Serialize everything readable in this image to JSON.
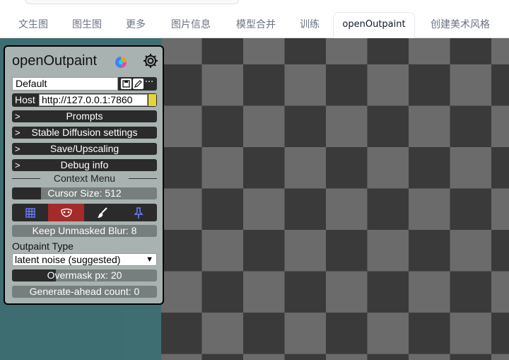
{
  "tabs": [
    {
      "label": "文生图"
    },
    {
      "label": "图生图"
    },
    {
      "label": "更多"
    },
    {
      "label": "图片信息"
    },
    {
      "label": "模型合并"
    },
    {
      "label": "训练"
    },
    {
      "label": "openOutpaint"
    },
    {
      "label": "创建美术风格"
    }
  ],
  "active_tab": "openOutpaint",
  "panel": {
    "title": "openOutpaint",
    "preset": {
      "value": "Default",
      "more_label": "···"
    },
    "host": {
      "label": "Host",
      "value": "http://127.0.0.1:7860"
    },
    "sections": [
      {
        "label": "Prompts"
      },
      {
        "label": "Stable Diffusion settings"
      },
      {
        "label": "Save/Upscaling"
      },
      {
        "label": "Debug info"
      }
    ],
    "context_menu_label": "Context Menu",
    "cursor_size": {
      "label": "Cursor Size: 512",
      "fraction": 0.2
    },
    "tools": [
      {
        "icon": "grid-icon",
        "active": false
      },
      {
        "icon": "mask-icon",
        "active": true
      },
      {
        "icon": "brush-icon",
        "active": false
      },
      {
        "icon": "pin-icon",
        "active": false
      }
    ],
    "keep_unmasked_blur": {
      "label": "Keep Unmasked Blur: 8",
      "fraction": 0.0
    },
    "outpaint_type": {
      "label": "Outpaint Type",
      "value": "latent noise (suggested)"
    },
    "overmask": {
      "label": "Overmask px: 20",
      "fraction": 0.3
    },
    "generate_ahead": {
      "label": "Generate-ahead count: 0",
      "fraction": 0.0
    }
  },
  "colors": {
    "panel_bg": "#a8b3b1",
    "control_dark": "#2b2b2b",
    "active_tool": "#a52a2a",
    "checker_light": "#6b6b6b",
    "checker_dark": "#3a3a3a",
    "teal_bg": "#3d6d70",
    "host_status": "#e3d53b"
  }
}
